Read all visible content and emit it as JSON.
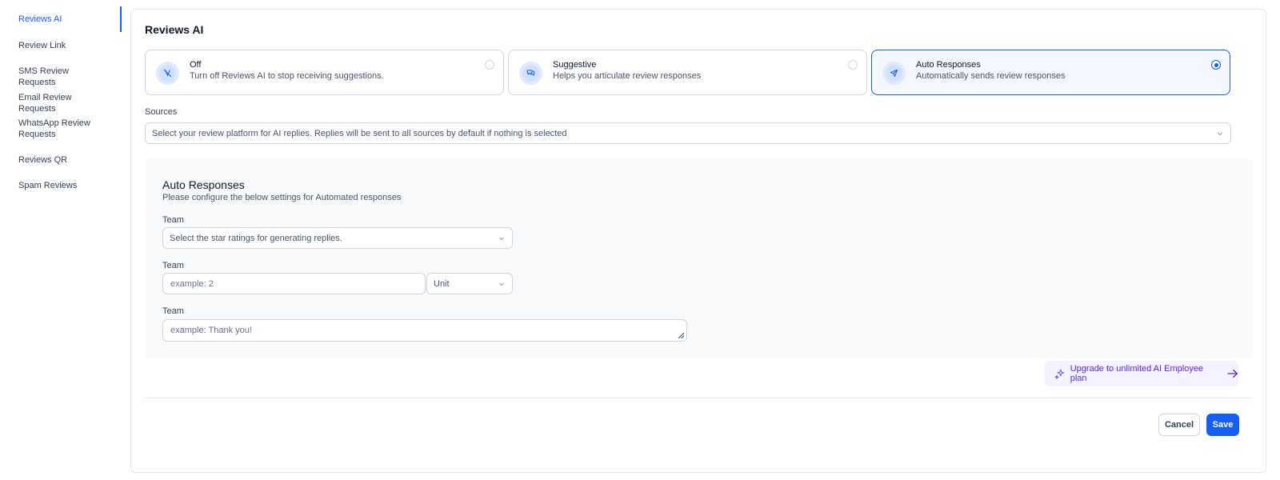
{
  "sidebar": {
    "items": [
      {
        "label": "Reviews AI",
        "active": true
      },
      {
        "label": "Review Link"
      },
      {
        "label": "SMS Review Requests"
      },
      {
        "label": "Email Review Requests"
      },
      {
        "label": "WhatsApp Review",
        "label2": "Requests"
      },
      {
        "label": "Reviews QR"
      },
      {
        "label": "Spam Reviews"
      }
    ]
  },
  "page": {
    "title": "Reviews AI"
  },
  "modes": [
    {
      "title": "Off",
      "description": "Turn off Reviews AI to stop receiving suggestions.",
      "icon": "ai-off-icon",
      "selected": false
    },
    {
      "title": "Suggestive",
      "description": "Helps you articulate review responses",
      "icon": "chat-bubbles-icon",
      "selected": false
    },
    {
      "title": "Auto Responses",
      "description": "Automatically sends review responses",
      "icon": "send-icon",
      "selected": true
    }
  ],
  "sources": {
    "label": "Sources",
    "placeholder": "Select your review platform for AI replies. Replies will be sent to all sources by default if nothing is selected"
  },
  "auto_responses": {
    "title": "Auto Responses",
    "subtitle": "Please configure the below settings for Automated responses",
    "star_ratings": {
      "label": "Team",
      "placeholder": "Select the star ratings for generating replies."
    },
    "delay": {
      "label": "Team",
      "placeholder": "example: 2",
      "unit_label": "Unit"
    },
    "footer": {
      "label": "Team",
      "placeholder": "example: Thank you!"
    }
  },
  "upgrade": {
    "label": "Upgrade to unlimited AI Employee plan"
  },
  "actions": {
    "cancel": "Cancel",
    "save": "Save"
  },
  "colors": {
    "accent": "#155eef",
    "upgrade_text": "#5925dc",
    "panel_bg": "#f9fafb"
  }
}
